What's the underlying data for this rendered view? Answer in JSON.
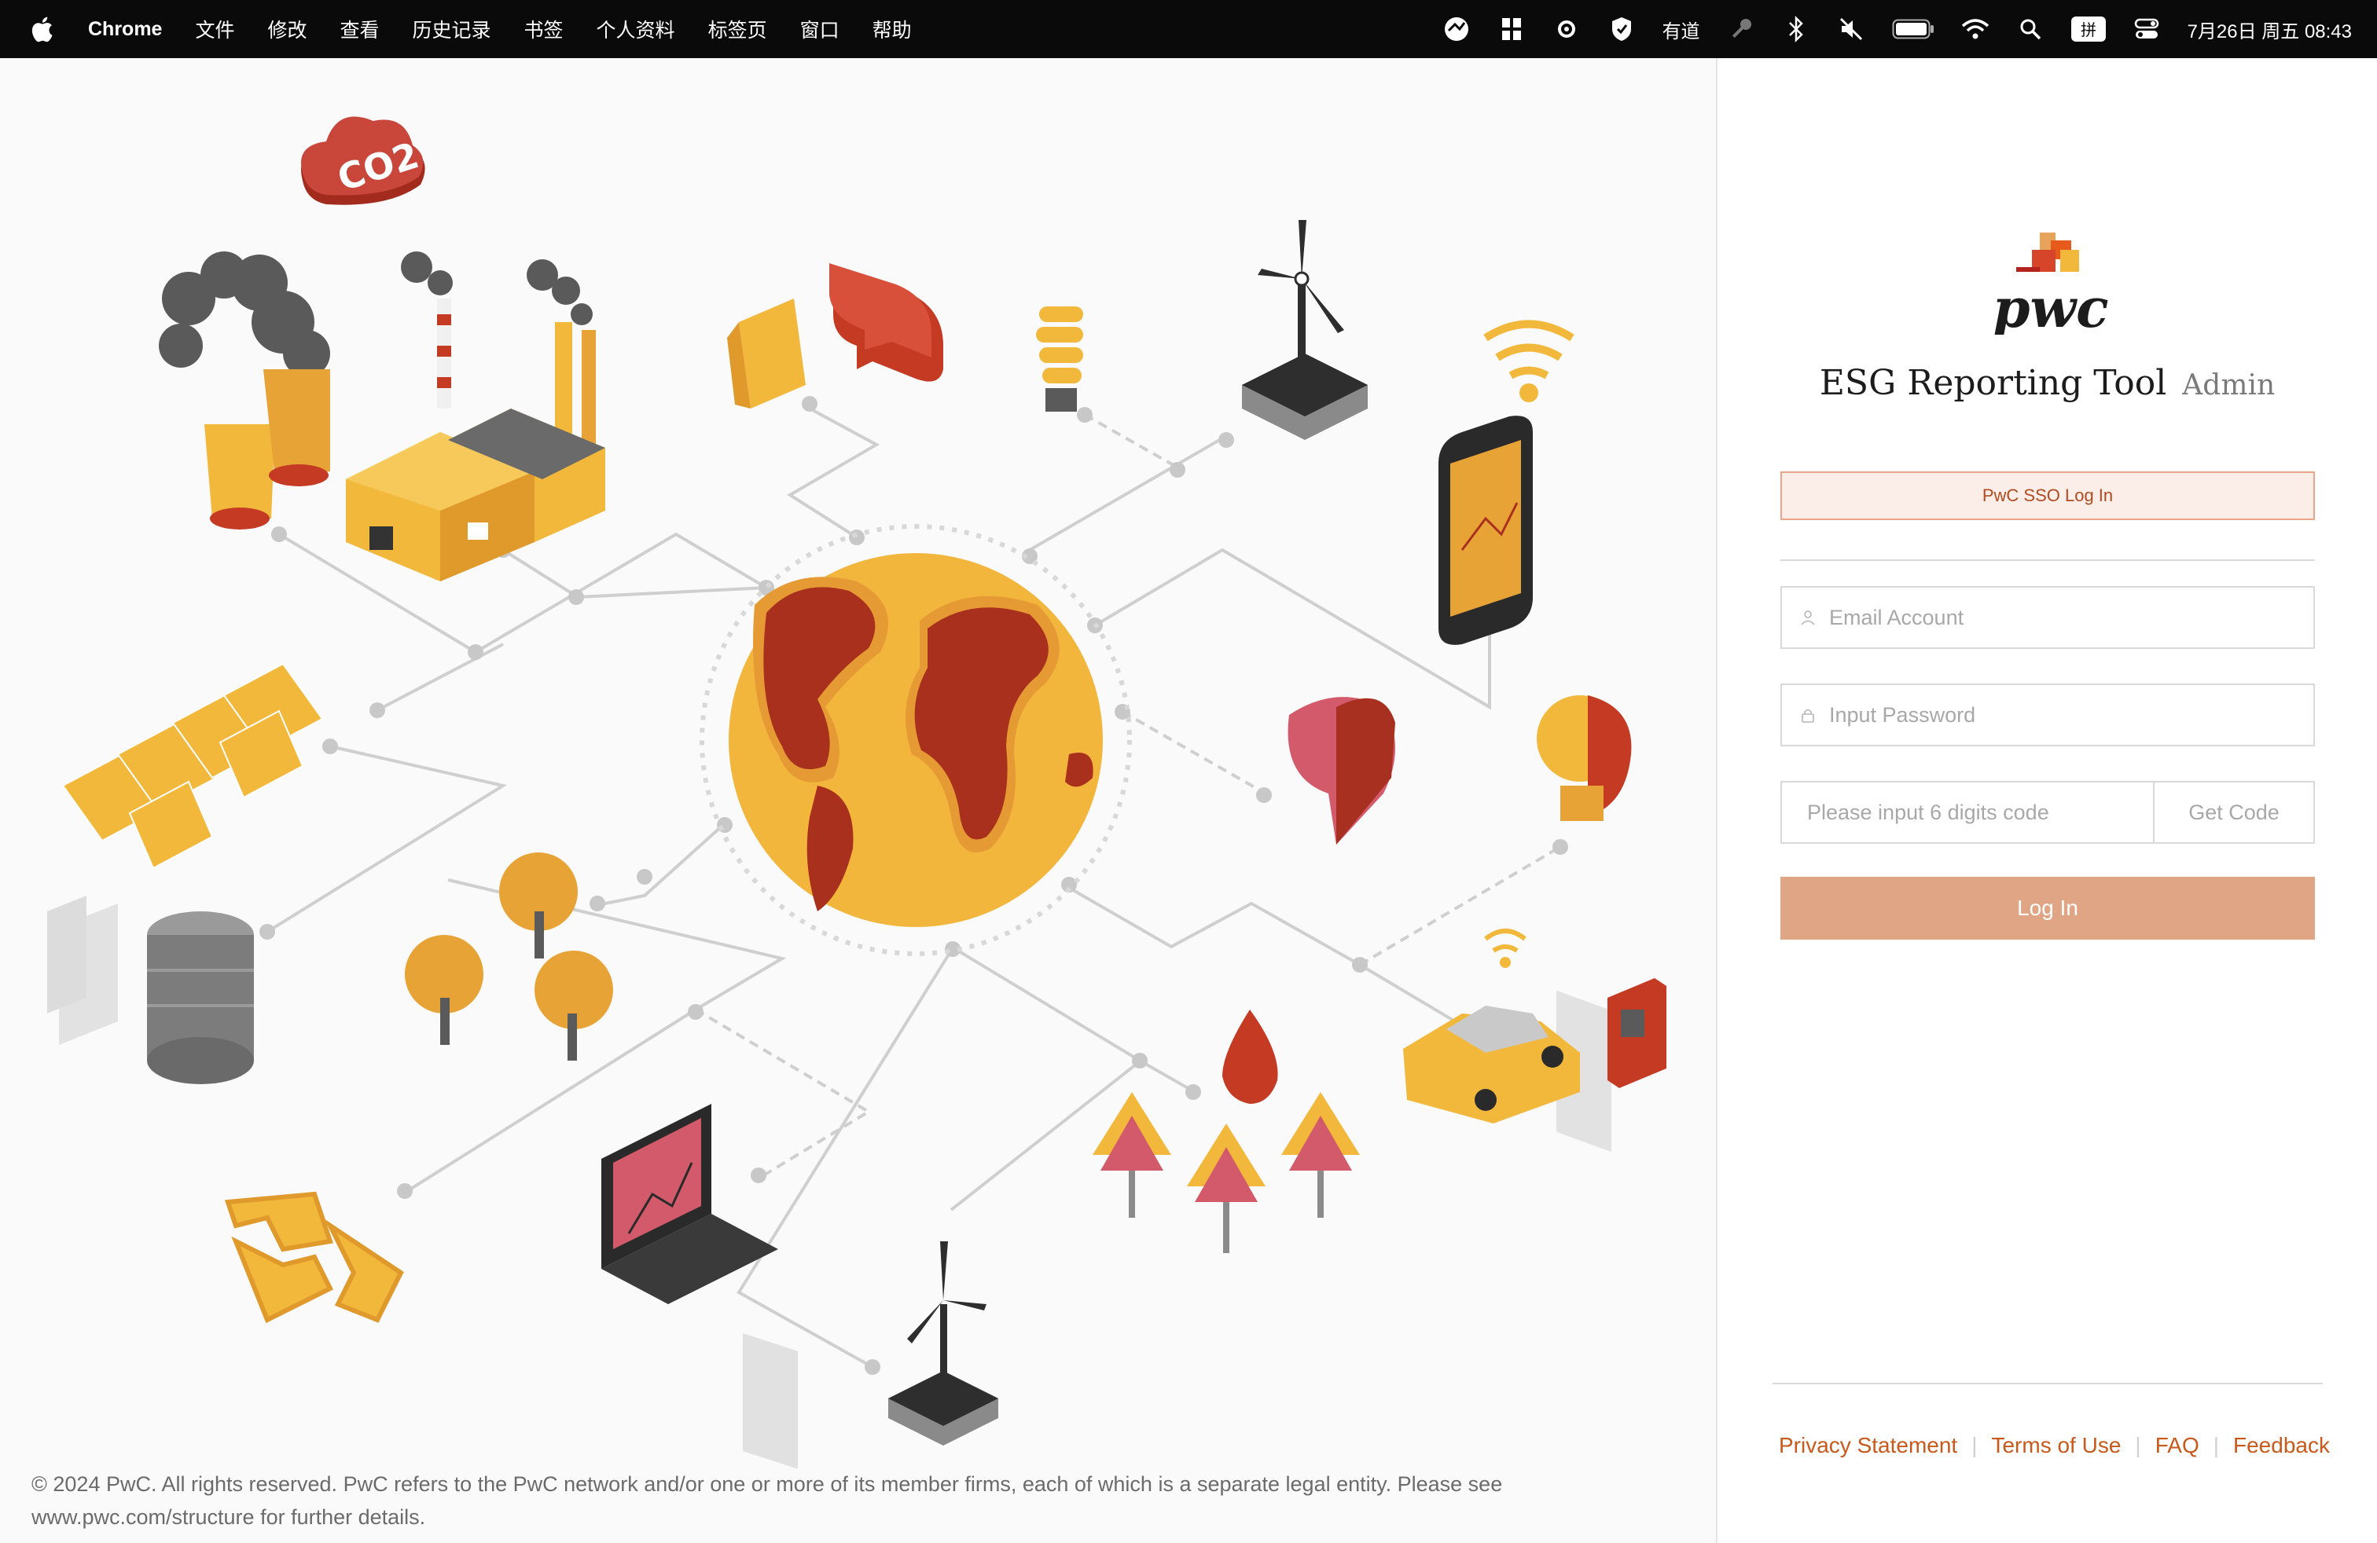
{
  "menubar": {
    "app_name": "Chrome",
    "items": [
      "文件",
      "修改",
      "查看",
      "历史记录",
      "书签",
      "个人资料",
      "标签页",
      "窗口",
      "帮助"
    ],
    "status_icons": [
      "vpn-icon",
      "puzzle-icon",
      "sync-icon",
      "shield-icon",
      "youdao-icon",
      "key-icon",
      "bluetooth-icon",
      "mute-icon",
      "battery-icon",
      "wifi-icon",
      "search-icon",
      "input-method-icon",
      "control-center-icon"
    ],
    "youdao_text": "有道",
    "input_method_text": "拼",
    "datetime": "7月26日 周五 08:43"
  },
  "illustration": {
    "co2_label": "CO2"
  },
  "footer": {
    "copyright": "© 2024 PwC. All rights reserved. PwC refers to the PwC network and/or one or more of its member firms, each of which is a separate legal entity. Please see www.pwc.com/structure for further details."
  },
  "login": {
    "logo_text": "pwc",
    "title": "ESG Reporting Tool",
    "title_suffix": "Admin",
    "sso_button": "PwC SSO Log In",
    "email_placeholder": "Email Account",
    "password_placeholder": "Input Password",
    "code_placeholder": "Please input 6 digits code",
    "get_code_button": "Get Code",
    "login_button": "Log In",
    "links": [
      "Privacy Statement",
      "Terms of Use",
      "FAQ",
      "Feedback"
    ]
  },
  "colors": {
    "brand_orange": "#c8591a",
    "login_button": "#e0a585",
    "illustration_yellow": "#f2b83b",
    "illustration_red": "#b0301d"
  }
}
